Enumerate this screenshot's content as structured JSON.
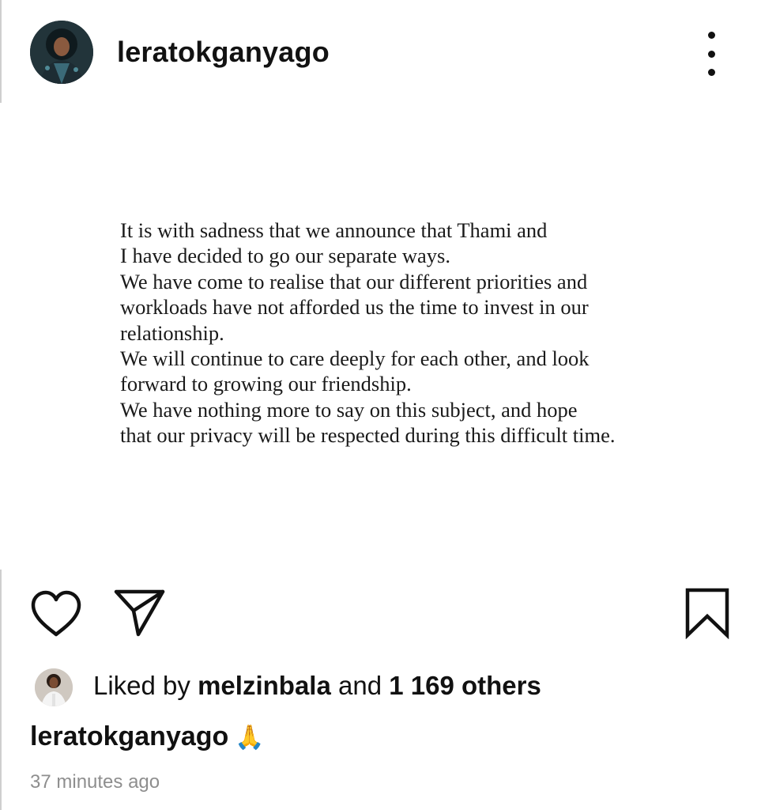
{
  "post": {
    "username": "leratokganyago",
    "letter_lines": [
      "It is with sadness that we announce that Thami and",
      "I have decided to go our separate ways.",
      "We have come to realise that our different priorities and",
      "workloads have not afforded us the time to invest in our",
      "relationship.",
      "We will continue to care deeply for each other, and look",
      "forward to growing our friendship.",
      "We have nothing more to say on this subject, and hope",
      "that our privacy will be respected during this difficult time."
    ],
    "likes": {
      "prefix": "Liked by ",
      "liked_by_user": "melzinbala",
      "connector": " and ",
      "others_text": "1 169 others"
    },
    "caption": {
      "username": "leratokganyago",
      "emoji": "🙏"
    },
    "timestamp": "37 minutes ago"
  },
  "icons": {
    "more": "more-options-icon",
    "like": "heart-icon",
    "share": "send-icon",
    "save": "bookmark-icon"
  },
  "colors": {
    "text": "#111111",
    "muted": "#8e8e8e",
    "background": "#ffffff"
  }
}
